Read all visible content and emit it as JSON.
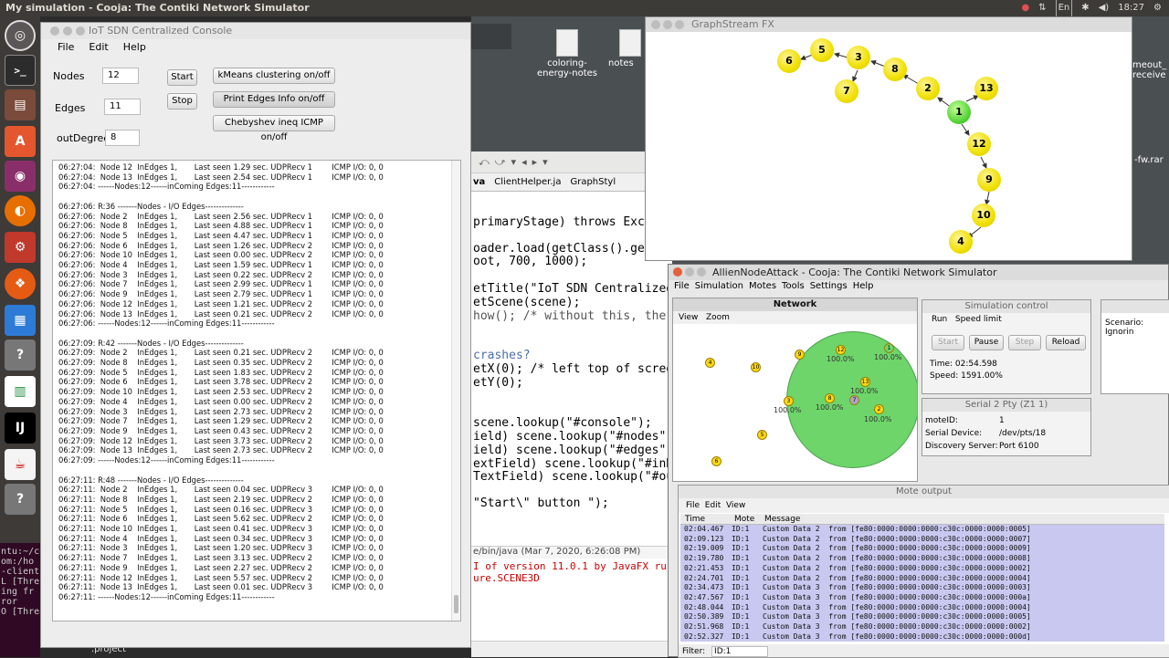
{
  "topbar": {
    "title": "My simulation - Cooja: The Contiki Network Simulator",
    "tray": [
      "●",
      "⇅",
      "En",
      "✱",
      "◀)",
      "18:27",
      "⚙"
    ]
  },
  "desktop": {
    "icons": [
      {
        "label": "coloring-energy-notes"
      },
      {
        "label": "notes"
      },
      {
        "label": "meout_receiver"
      },
      {
        "label": "-fw.rar"
      }
    ]
  },
  "bgterminal": [
    "ntu:~/co",
    "om:/ho",
    "-client",
    "L [Thre",
    "ing fr",
    "ror",
    "O [Threa"
  ],
  "ide": {
    "tabs": [
      "va",
      "ClientHelper.ja",
      "GraphStyl"
    ],
    "code": [
      "primaryStage) throws Excep",
      "oader.load(getClass().getRe",
      "oot, 700, 1000);",
      "",
      "etTitle(\"IoT SDN Centralized C",
      "etScene(scene);",
      "how(); /* without this, the Ja",
      "",
      "crashes?",
      "etX(0); /* left top of screen",
      "etY(0);",
      "",
      "scene.lookup(\"#console\");",
      "ield) scene.lookup(\"#nodes\");",
      "ield) scene.lookup(\"#edges\");",
      "extField) scene.lookup(\"#inDeg",
      "TextField) scene.lookup(\"#out",
      "",
      "\"Start\\\" button \");"
    ],
    "console_header": "e/bin/java (Mar 7, 2020, 6:26:08 PM)",
    "errors": [
      "I of version 11.0.1 by JavaFX ru",
      "ure.SCENE3D"
    ],
    "bottom": ".project"
  },
  "console": {
    "title": "IoT SDN Centralized Console",
    "menu": [
      "File",
      "Edit",
      "Help"
    ],
    "nodes_label": "Nodes",
    "nodes_value": "12",
    "edges_label": "Edges",
    "edges_value": "11",
    "outdeg_label": "outDegree",
    "outdeg_value": "8",
    "start": "Start",
    "stop": "Stop",
    "kmeans": "kMeans clustering on/off",
    "print_edges": "Print Edges Info on/off",
    "chebyshev": "Chebyshev ineq ICMP on/off",
    "log": "06:27:04:  Node 12  InEdges 1,       Last seen 1.29 sec. UDPRecv 1        ICMP I/O: 0, 0\n06:27:04:  Node 13  InEdges 1,       Last seen 2.54 sec. UDPRecv 1        ICMP I/O: 0, 0\n06:27:04: ------Nodes:12------inComing Edges:11------------\n\n06:27:06: R:36 -------Nodes - I/O Edges--------------\n06:27:06:  Node 2    InEdges 1,       Last seen 2.56 sec. UDPRecv 1        ICMP I/O: 0, 0\n06:27:06:  Node 8    InEdges 1,       Last seen 4.88 sec. UDPRecv 1        ICMP I/O: 0, 0\n06:27:06:  Node 5    InEdges 1,       Last seen 4.47 sec. UDPRecv 1        ICMP I/O: 0, 0\n06:27:06:  Node 6    InEdges 1,       Last seen 1.26 sec. UDPRecv 2        ICMP I/O: 0, 0\n06:27:06:  Node 10  InEdges 1,       Last seen 0.00 sec. UDPRecv 2        ICMP I/O: 0, 0\n06:27:06:  Node 4    InEdges 1,       Last seen 1.59 sec. UDPRecv 1        ICMP I/O: 0, 0\n06:27:06:  Node 3    InEdges 1,       Last seen 0.22 sec. UDPRecv 2        ICMP I/O: 0, 0\n06:27:06:  Node 7    InEdges 1,       Last seen 2.99 sec. UDPRecv 1        ICMP I/O: 0, 0\n06:27:06:  Node 9    InEdges 1,       Last seen 2.79 sec. UDPRecv 1        ICMP I/O: 0, 0\n06:27:06:  Node 12  InEdges 1,       Last seen 1.21 sec. UDPRecv 2        ICMP I/O: 0, 0\n06:27:06:  Node 13  InEdges 1,       Last seen 0.21 sec. UDPRecv 2        ICMP I/O: 0, 0\n06:27:06: ------Nodes:12------inComing Edges:11------------\n\n06:27:09: R:42 -------Nodes - I/O Edges--------------\n06:27:09:  Node 2    InEdges 1,       Last seen 0.21 sec. UDPRecv 2        ICMP I/O: 0, 0\n06:27:09:  Node 8    InEdges 1,       Last seen 0.35 sec. UDPRecv 2        ICMP I/O: 0, 0\n06:27:09:  Node 5    InEdges 1,       Last seen 1.83 sec. UDPRecv 2        ICMP I/O: 0, 0\n06:27:09:  Node 6    InEdges 1,       Last seen 3.78 sec. UDPRecv 2        ICMP I/O: 0, 0\n06:27:09:  Node 10  InEdges 1,       Last seen 2.53 sec. UDPRecv 2        ICMP I/O: 0, 0\n06:27:09:  Node 4    InEdges 1,       Last seen 0.00 sec. UDPRecv 2        ICMP I/O: 0, 0\n06:27:09:  Node 3    InEdges 1,       Last seen 2.73 sec. UDPRecv 2        ICMP I/O: 0, 0\n06:27:09:  Node 7    InEdges 1,       Last seen 1.29 sec. UDPRecv 2        ICMP I/O: 0, 0\n06:27:09:  Node 9    InEdges 1,       Last seen 0.43 sec. UDPRecv 2        ICMP I/O: 0, 0\n06:27:09:  Node 12  InEdges 1,       Last seen 3.73 sec. UDPRecv 2        ICMP I/O: 0, 0\n06:27:09:  Node 13  InEdges 1,       Last seen 2.73 sec. UDPRecv 2        ICMP I/O: 0, 0\n06:27:09: ------Nodes:12------inComing Edges:11------------\n\n06:27:11: R:48 -------Nodes - I/O Edges--------------\n06:27:11:  Node 2    InEdges 1,       Last seen 0.04 sec. UDPRecv 3        ICMP I/O: 0, 0\n06:27:11:  Node 8    InEdges 1,       Last seen 2.19 sec. UDPRecv 2        ICMP I/O: 0, 0\n06:27:11:  Node 5    InEdges 1,       Last seen 0.16 sec. UDPRecv 3        ICMP I/O: 0, 0\n06:27:11:  Node 6    InEdges 1,       Last seen 5.62 sec. UDPRecv 2        ICMP I/O: 0, 0\n06:27:11:  Node 10  InEdges 1,       Last seen 0.41 sec. UDPRecv 3        ICMP I/O: 0, 0\n06:27:11:  Node 4    InEdges 1,       Last seen 0.34 sec. UDPRecv 3        ICMP I/O: 0, 0\n06:27:11:  Node 3    InEdges 1,       Last seen 1.20 sec. UDPRecv 3        ICMP I/O: 0, 0\n06:27:11:  Node 7    InEdges 1,       Last seen 3.13 sec. UDPRecv 2        ICMP I/O: 0, 0\n06:27:11:  Node 9    InEdges 1,       Last seen 2.27 sec. UDPRecv 2        ICMP I/O: 0, 0\n06:27:11:  Node 12  InEdges 1,       Last seen 5.57 sec. UDPRecv 2        ICMP I/O: 0, 0\n06:27:11:  Node 13  InEdges 1,       Last seen 0.01 sec. UDPRecv 3        ICMP I/O: 0, 0\n06:27:11: ------Nodes:12------inComing Edges:11------------"
  },
  "graph": {
    "title": "GraphStream FX",
    "nodes": [
      "1",
      "2",
      "3",
      "4",
      "5",
      "6",
      "7",
      "8",
      "9",
      "10",
      "12",
      "13"
    ]
  },
  "cooja": {
    "title": "AllienNodeAttack - Cooja: The Contiki Network Simulator",
    "menu": [
      "File",
      "Simulation",
      "Motes",
      "Tools",
      "Settings",
      "Help"
    ],
    "network": {
      "title": "Network",
      "menu": [
        "View",
        "Zoom"
      ],
      "motes": [
        "4",
        "10",
        "9",
        "12",
        "1",
        "5",
        "3",
        "13",
        "8",
        "7",
        "2",
        "6"
      ],
      "pct": "100.0%"
    },
    "simctl": {
      "title": "Simulation control",
      "menu": [
        "Run",
        "Speed limit"
      ],
      "start": "Start",
      "pause": "Pause",
      "step": "Step",
      "reload": "Reload",
      "time": "Time: 02:54.598",
      "speed": "Speed: 1591.00%"
    },
    "notes": {
      "text": "Scenario: Ignorin"
    },
    "serial": {
      "title": "Serial 2 Pty (Z1 1)",
      "rows": [
        [
          "moteID:",
          "1"
        ],
        [
          "Serial Device:",
          "/dev/pts/18"
        ],
        [
          "Discovery Server:",
          "Port 6100"
        ]
      ]
    },
    "moteout": {
      "title": "Mote output",
      "menu": [
        "File",
        "Edit",
        "View"
      ],
      "cols": [
        "Time",
        "Mote",
        "Message"
      ],
      "rows": [
        [
          "02:04.467",
          "ID:1",
          "Custom Data 2  from [fe80:0000:0000:0000:c30c:0000:0000:0005]"
        ],
        [
          "02:09.123",
          "ID:1",
          "Custom Data 2  from [fe80:0000:0000:0000:c30c:0000:0000:0007]"
        ],
        [
          "02:19.009",
          "ID:1",
          "Custom Data 2  from [fe80:0000:0000:0000:c30c:0000:0000:0009]"
        ],
        [
          "02:19.780",
          "ID:1",
          "Custom Data 2  from [fe80:0000:0000:0000:c30c:0000:0000:0008]"
        ],
        [
          "02:21.453",
          "ID:1",
          "Custom Data 2  from [fe80:0000:0000:0000:c30c:0000:0000:0002]"
        ],
        [
          "02:24.701",
          "ID:1",
          "Custom Data 2  from [fe80:0000:0000:0000:c30c:0000:0000:0004]"
        ],
        [
          "02:34.473",
          "ID:1",
          "Custom Data 3  from [fe80:0000:0000:0000:c30c:0000:0000:0003]"
        ],
        [
          "02:47.567",
          "ID:1",
          "Custom Data 3  from [fe80:0000:0000:0000:c30c:0000:0000:000a]"
        ],
        [
          "02:48.044",
          "ID:1",
          "Custom Data 3  from [fe80:0000:0000:0000:c30c:0000:0000:0004]"
        ],
        [
          "02:50.389",
          "ID:1",
          "Custom Data 3  from [fe80:0000:0000:0000:c30c:0000:0000:0005]"
        ],
        [
          "02:51.968",
          "ID:1",
          "Custom Data 3  from [fe80:0000:0000:0000:c30c:0000:0000:0002]"
        ],
        [
          "02:52.327",
          "ID:1",
          "Custom Data 3  from [fe80:0000:0000:0000:c30c:0000:0000:000d]"
        ]
      ],
      "filter": "Filter:",
      "filter_value": "ID:1"
    }
  }
}
